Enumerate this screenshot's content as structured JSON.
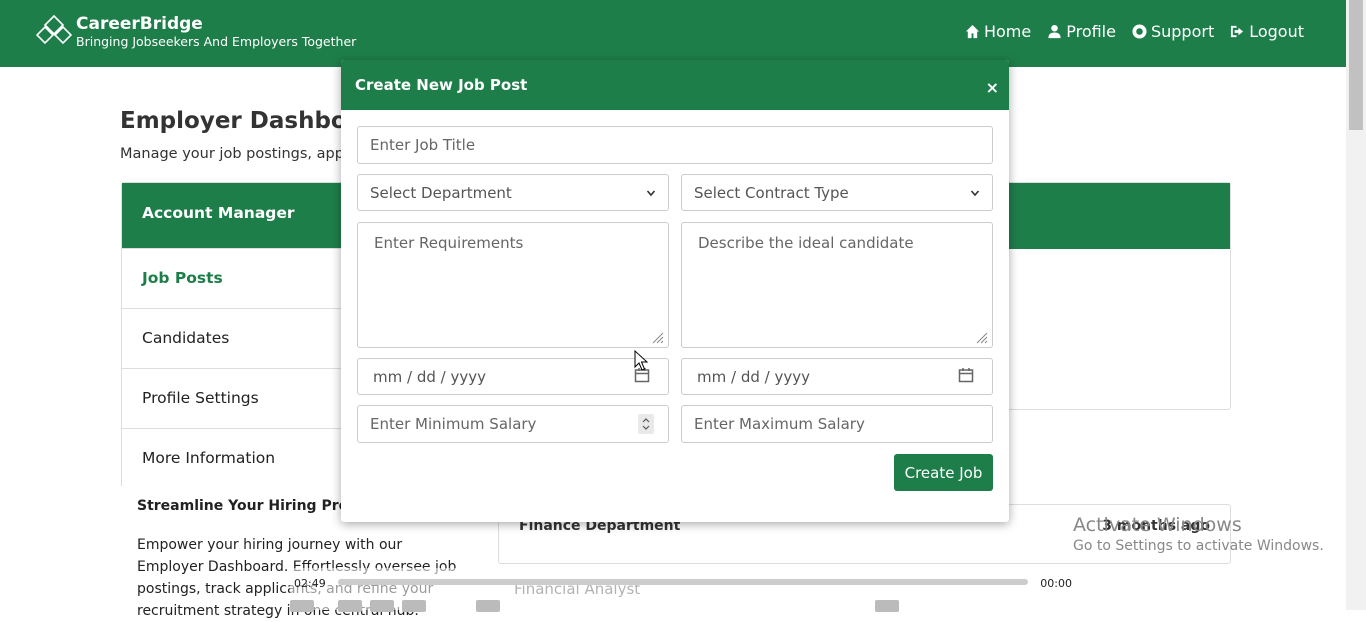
{
  "nav": {
    "brand_name": "CareerBridge",
    "brand_tagline": "Bringing Jobseekers And Employers Together",
    "links": [
      {
        "label": "Home",
        "icon": "home-icon"
      },
      {
        "label": "Profile",
        "icon": "user-icon"
      },
      {
        "label": "Support",
        "icon": "lifebuoy-icon"
      },
      {
        "label": "Logout",
        "icon": "sign-out-icon"
      }
    ]
  },
  "dashboard": {
    "title": "Employer Dashboard",
    "subtitle": "Manage your job postings, applic",
    "panel_header": "Account Manager",
    "sidebar": [
      {
        "label": "Job Posts",
        "active": true
      },
      {
        "label": "Candidates",
        "active": false
      },
      {
        "label": "Profile Settings",
        "active": false
      },
      {
        "label": "More Information",
        "active": false
      }
    ],
    "info_title": "Streamline Your Hiring Process",
    "info_text": "Empower your hiring journey with our Employer Dashboard. Effortlessly oversee job postings, track applicants, and refine your recruitment strategy in one central hub.",
    "job_card": {
      "department": "Finance Department",
      "age": "3 months ago",
      "role": "Financial Analyst"
    }
  },
  "modal": {
    "title": "Create New Job Post",
    "close": "×",
    "job_title_placeholder": "Enter Job Title",
    "department_select": "Select Department",
    "contract_select": "Select Contract Type",
    "requirements_placeholder": "Enter Requirements",
    "candidate_placeholder": "Describe the ideal candidate",
    "date_placeholder": "mm / dd / yyyy",
    "min_salary_placeholder": "Enter Minimum Salary",
    "max_salary_placeholder": "Enter Maximum Salary",
    "submit_label": "Create Job"
  },
  "video_overlay": {
    "elapsed": "02:49",
    "remaining": "00:00"
  },
  "watermark": {
    "line1": "Activate Windows",
    "line2": "Go to Settings to activate Windows."
  },
  "colors": {
    "brand_green": "#1e7e4a"
  }
}
